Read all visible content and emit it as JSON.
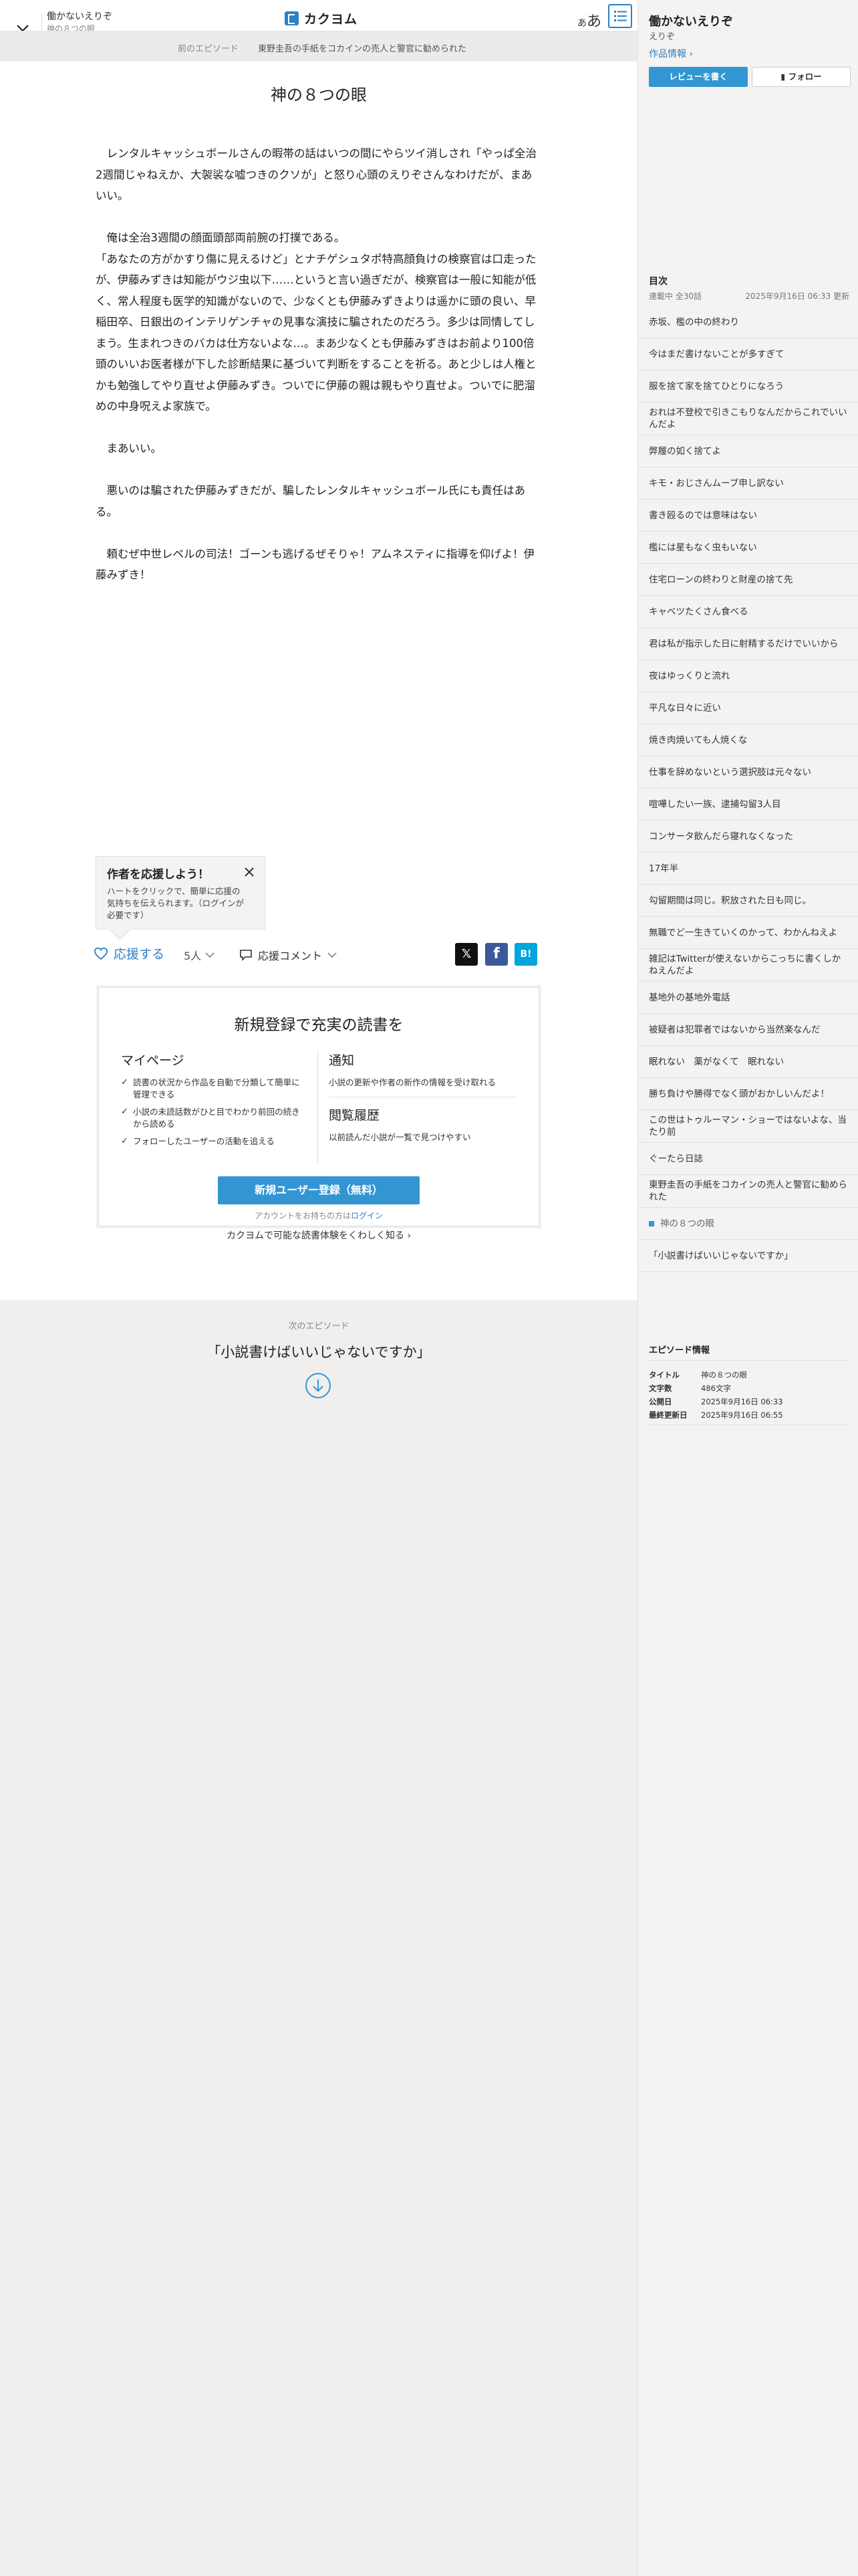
{
  "header": {
    "work_title": "働かないえりぞ",
    "episode_title": "神の８つの眼",
    "logo_text": "カクヨム",
    "font_button": "あ",
    "font_button_small": "あ"
  },
  "breadcrumb": {
    "prev_label": "前のエピソード",
    "prev_title": "東野圭吾の手紙をコカインの売人と警官に勧められた"
  },
  "episode": {
    "title": "神の８つの眼",
    "paragraphs": [
      "　レンタルキャッシュボールさんの暇帯の話はいつの間にやらツイ消しされ「やっぱ全治2週間じゃねえか、大袈裟な嘘つきのクソが」と怒り心頭のえりぞさんなわけだが、まあいい。",
      "",
      "　俺は全治3週間の顔面頭部両前腕の打撲である。\n「あなたの方がかすり傷に見えるけど」とナチゲシュタポ特高顔負けの検察官は口走ったが、伊藤みずきは知能がウジ虫以下……というと言い過ぎだが、検察官は一般に知能が低く、常人程度も医学的知識がないので、少なくとも伊藤みずきよりは遥かに頭の良い、早稲田卒、日銀出のインテリゲンチャの見事な演技に騙されたのだろう。多少は同情してしまう。生まれつきのバカは仕方ないよな…。まあ少なくとも伊藤みずきはお前より100倍頭のいいお医者様が下した診断結果に基づいて判断をすることを祈る。あと少しは人権とかも勉強してやり直せよ伊藤みずき。ついでに伊藤の親は親もやり直せよ。ついでに肥溜めの中身呪えよ家族で。",
      "",
      "　まあいい。",
      "",
      "　悪いのは騙された伊藤みずきだが、騙したレンタルキャッシュボール氏にも責任はある。",
      "",
      "　頼むぜ中世レベルの司法！ゴーンも逃げるぜそりゃ！アムネスティに指導を仰げよ！伊藤みずき！"
    ]
  },
  "tooltip": {
    "title": "作者を応援しよう！",
    "body": "ハートをクリックで、簡単に応援の気持ちを伝えられます。（ログインが必要です）"
  },
  "support": {
    "cheer_label": "応援する",
    "cheer_count": "5人",
    "comment_label": "応援コメント",
    "share_x": "𝕏",
    "share_fb": "f",
    "share_hb": "B!"
  },
  "register": {
    "title": "新規登録で充実の読書を",
    "mypage_h": "マイページ",
    "mypage_items": [
      "読書の状況から作品を自動で分類して簡単に管理できる",
      "小説の未読話数がひと目でわかり前回の続きから読める",
      "フォローしたユーザーの活動を追える"
    ],
    "notice_h": "通知",
    "notice_text": "小説の更新や作者の新作の情報を受け取れる",
    "history_h": "閲覧履歴",
    "history_text": "以前読んだ小説が一覧で見つけやすい",
    "cta": "新規ユーザー登録（無料）",
    "login_prefix": "アカウントをお持ちの方は",
    "login_link": "ログイン",
    "more": "カクヨムで可能な読書体験をくわしく知る"
  },
  "next": {
    "label": "次のエピソード",
    "title": "「小説書けばいいじゃないですか」"
  },
  "sidebar": {
    "work_title": "働かないえりぞ",
    "author": "えりぞ",
    "info_link": "作品情報",
    "review_btn": "レビューを書く",
    "follow_btn": "フォロー",
    "toc_heading": "目次",
    "toc_status": "連載中 全30話",
    "toc_updated": "2025年9月16日 06:33 更新",
    "toc": [
      "赤坂、檻の中の終わり",
      "今はまだ書けないことが多すぎて",
      "服を捨て家を捨てひとりになろう",
      "おれは不登校で引きこもりなんだからこれでいいんだよ",
      "弊履の如く捨てよ",
      "キモ・おじさんムーブ申し訳ない",
      "書き殴るのでは意味はない",
      "檻には星もなく虫もいない",
      "住宅ローンの終わりと財産の捨て先",
      "キャベツたくさん食べる",
      "君は私が指示した日に射精するだけでいいから",
      "夜はゆっくりと流れ",
      "平凡な日々に近い",
      "焼き肉焼いても人焼くな",
      "仕事を辞めないという選択肢は元々ない",
      "喧嘩したい一族、逮捕勾留3人目",
      "コンサータ飲んだら寝れなくなった",
      "17年半",
      "勾留期間は同じ。釈放された日も同じ。",
      "無職でど一生きていくのかって、わかんねえよ",
      "雑記はTwitterが使えないからこっちに書くしかねえんだよ",
      "基地外の基地外電話",
      "被疑者は犯罪者ではないから当然楽なんだ",
      "眠れない　薬がなくて　眠れない",
      "勝ち負けや勝得でなく頭がおかしいんだよ！",
      "この世はトゥルーマン・ショーではないよな、当たり前",
      "ぐーたら日誌",
      "東野圭吾の手紙をコカインの売人と警官に勧められた",
      "神の８つの眼",
      "「小説書けばいいじゃないですか」"
    ],
    "current_index": 28,
    "ep_info_heading": "エピソード情報",
    "ep_info": [
      {
        "k": "タイトル",
        "v": "神の８つの眼"
      },
      {
        "k": "文字数",
        "v": "486文字"
      },
      {
        "k": "公開日",
        "v": "2025年9月16日 06:33"
      },
      {
        "k": "最終更新日",
        "v": "2025年9月16日 06:55"
      }
    ]
  },
  "colors": {
    "accent": "#3396d3",
    "link": "#2e7fc3",
    "background": "#f0efed"
  }
}
